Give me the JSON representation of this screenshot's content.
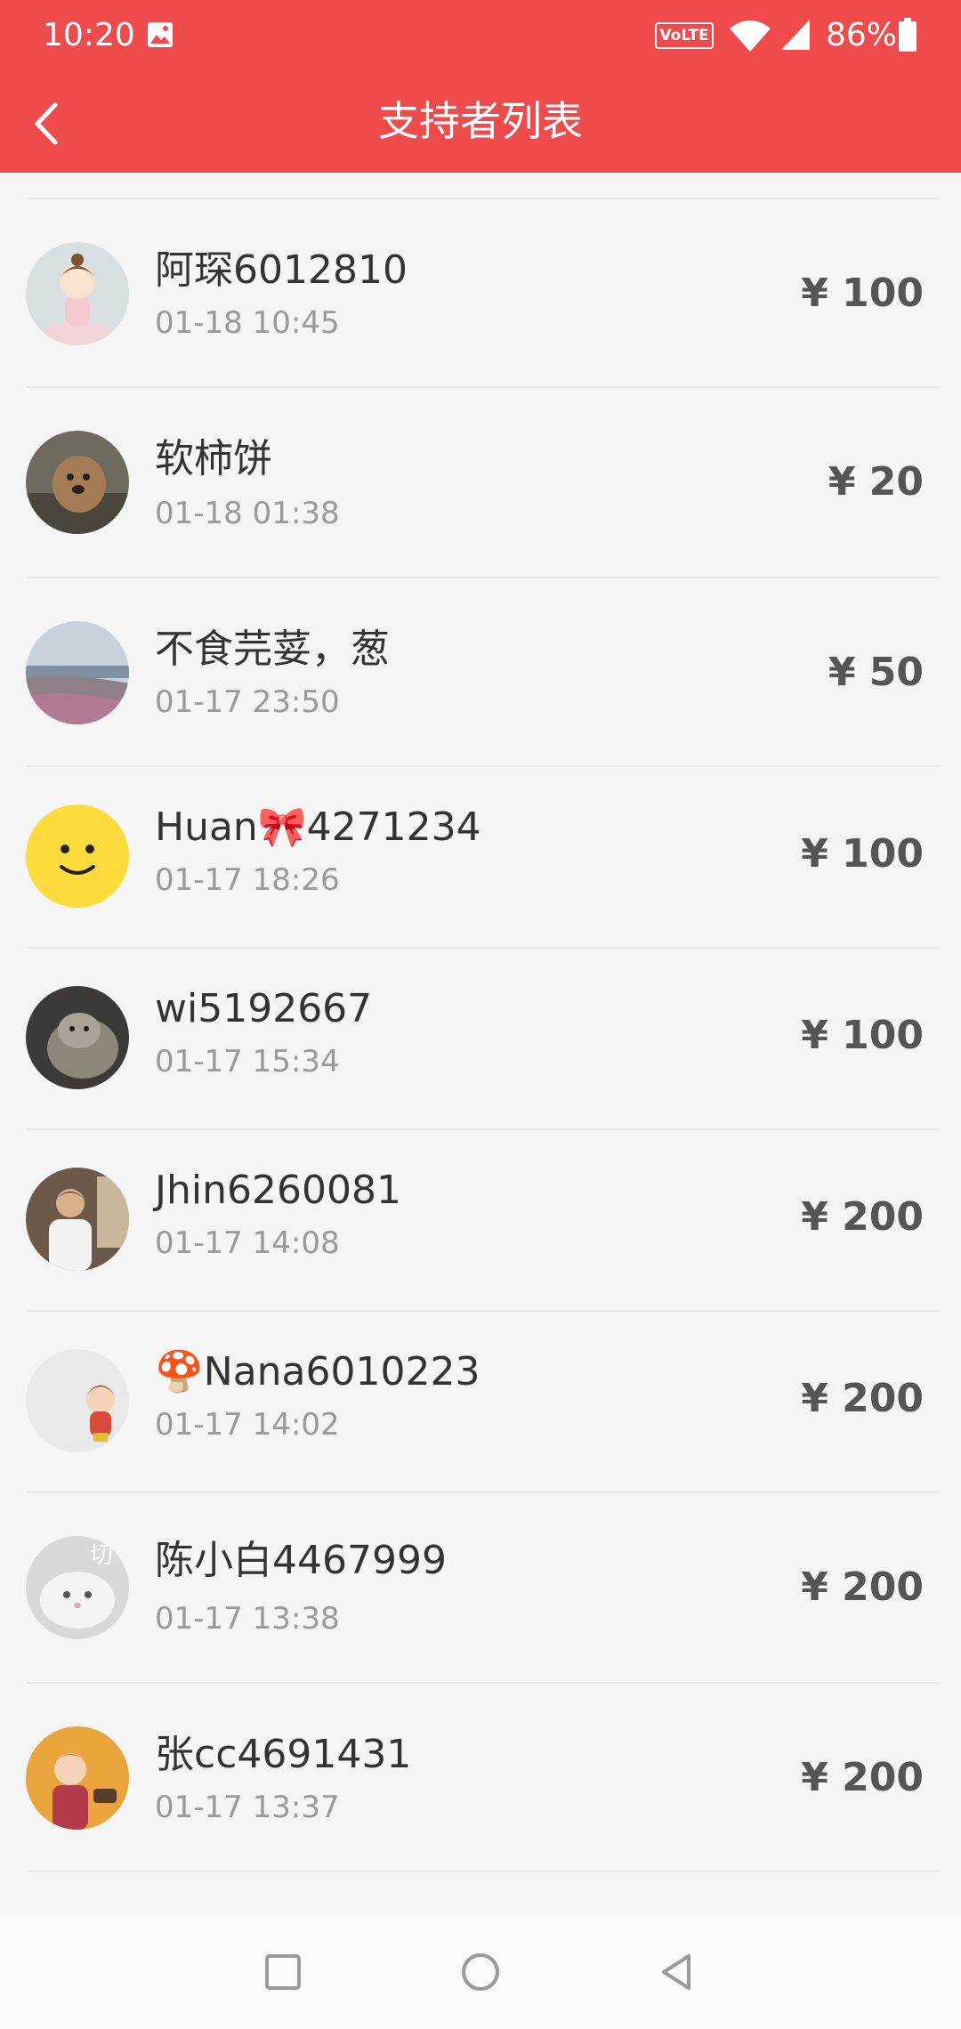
{
  "status_bar": {
    "time": "10:20",
    "volte": "VoLTE",
    "battery": "86%",
    "icons": [
      "gallery-icon",
      "wifi-icon",
      "signal-icon",
      "battery-icon"
    ]
  },
  "header": {
    "title": "支持者列表",
    "back_icon": "chevron-left-icon",
    "background": "#ef4b4c"
  },
  "supporters": [
    {
      "name": "阿琛6012810",
      "time": "01-18 10:45",
      "amount": "¥ 100"
    },
    {
      "name": "软柿饼",
      "time": "01-18 01:38",
      "amount": "¥ 20"
    },
    {
      "name": "不食芫荽，葱",
      "time": "01-17 23:50",
      "amount": "¥ 50"
    },
    {
      "name": "Huan🎀4271234",
      "time": "01-17 18:26",
      "amount": "¥ 100"
    },
    {
      "name": "wi5192667",
      "time": "01-17 15:34",
      "amount": "¥ 100"
    },
    {
      "name": "Jhin6260081",
      "time": "01-17 14:08",
      "amount": "¥ 200"
    },
    {
      "name": "🍄Nana6010223",
      "time": "01-17 14:02",
      "amount": "¥ 200"
    },
    {
      "name": "陈小白4467999",
      "time": "01-17 13:38",
      "amount": "¥ 200"
    },
    {
      "name": "张cc4691431",
      "time": "01-17 13:37",
      "amount": "¥ 200"
    }
  ],
  "avatar_badge": "切",
  "nav_bar": {
    "icons": [
      "recents-square-icon",
      "home-circle-icon",
      "back-triangle-icon"
    ]
  }
}
